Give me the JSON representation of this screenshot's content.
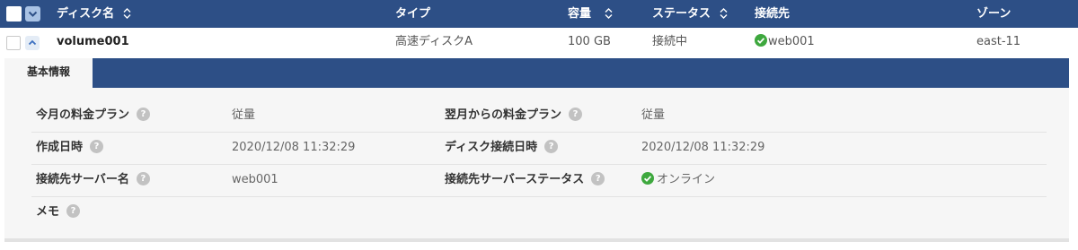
{
  "table": {
    "columns": {
      "name": "ディスク名",
      "type": "タイプ",
      "capacity": "容量",
      "status": "ステータス",
      "connection": "接続先",
      "zone": "ゾーン"
    },
    "rows": [
      {
        "name": "volume001",
        "type": "高速ディスクA",
        "capacity": "100 GB",
        "status": "接続中",
        "connection": "web001",
        "zone": "east-11"
      }
    ]
  },
  "detail": {
    "tab_label": "基本情報",
    "fields": {
      "monthly_plan_label": "今月の料金プラン",
      "monthly_plan_value": "従量",
      "next_plan_label": "翌月からの料金プラン",
      "next_plan_value": "従量",
      "created_label": "作成日時",
      "created_value": "2020/12/08 11:32:29",
      "disk_connected_label": "ディスク接続日時",
      "disk_connected_value": "2020/12/08 11:32:29",
      "server_name_label": "接続先サーバー名",
      "server_name_value": "web001",
      "server_status_label": "接続先サーバーステータス",
      "server_status_value": "オンライン",
      "memo_label": "メモ"
    }
  },
  "icons": {
    "help": "question-circle-icon",
    "status_ok": "check-circle-icon",
    "sort": "sort-updown-icon",
    "expand": "chevron-down-icon",
    "collapse": "chevron-up-icon"
  },
  "colors": {
    "header_bg": "#2d4f86",
    "success": "#3ea83e",
    "help_icon": "#c2c2c2"
  }
}
